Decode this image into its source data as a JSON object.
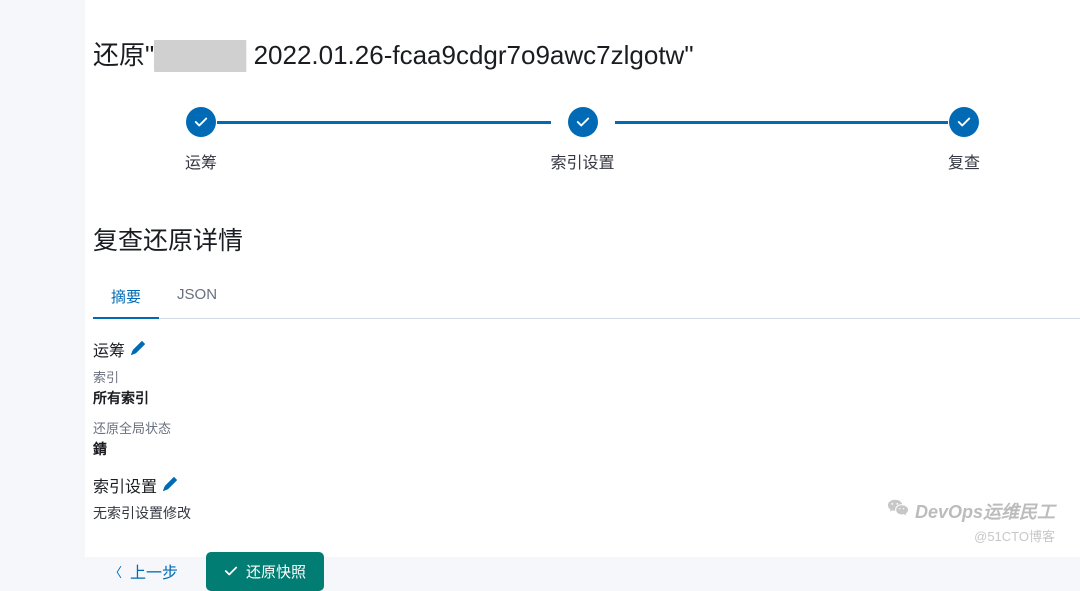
{
  "page": {
    "title_prefix": "还原\"",
    "title_masked": "█████",
    "title_suffix": "2022.01.26-fcaa9cdgr7o9awc7zlgotw\""
  },
  "stepper": {
    "steps": [
      {
        "label": "运筹",
        "done": true
      },
      {
        "label": "索引设置",
        "done": true
      },
      {
        "label": "复查",
        "done": true
      }
    ]
  },
  "section": {
    "title": "复查还原详情"
  },
  "tabs": {
    "summary": "摘要",
    "json": "JSON"
  },
  "details": {
    "logistics": {
      "title": "运筹",
      "index_label": "索引",
      "index_value": "所有索引",
      "global_state_label": "还原全局状态",
      "global_state_value": "錆"
    },
    "index_settings": {
      "title": "索引设置",
      "no_changes": "无索引设置修改"
    }
  },
  "buttons": {
    "back": "上一步",
    "restore": "还原快照"
  },
  "watermark": {
    "main": "DevOps运维民工",
    "sub": "@51CTO博客"
  }
}
